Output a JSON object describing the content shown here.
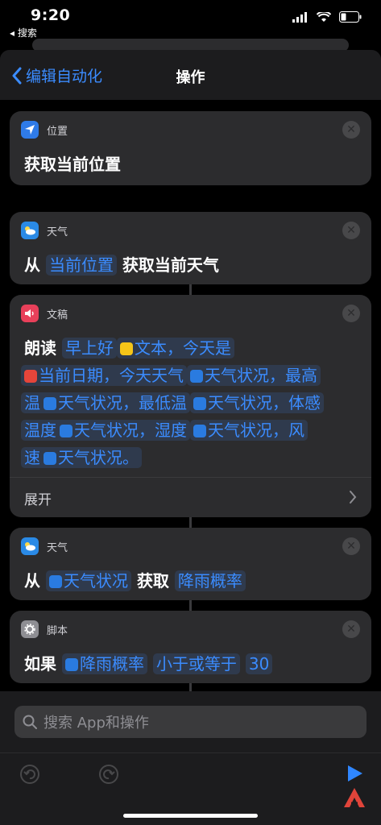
{
  "status": {
    "time": "9:20",
    "back_app": "◂ 搜索"
  },
  "nav": {
    "back_label": "编辑自动化",
    "title": "操作"
  },
  "cards": [
    {
      "app": "位置",
      "line": "获取当前位置"
    },
    {
      "app": "天气",
      "parts": [
        "从",
        "当前位置",
        "获取当前天气"
      ]
    },
    {
      "app": "文稿",
      "lines": [
        [
          "朗读",
          "早上好",
          "文本",
          "，今天是"
        ],
        [
          "当前日期",
          "，今天天气",
          "天气状况",
          "，最高"
        ],
        [
          "温",
          "天气状况",
          "，最低温",
          "天气状况",
          "，体感"
        ],
        [
          "温度",
          "天气状况",
          "，湿度",
          "天气状况",
          "，风"
        ],
        [
          "速",
          "天气状况",
          "。"
        ]
      ],
      "expand": "展开"
    },
    {
      "app": "天气",
      "parts": [
        "从",
        "天气状况",
        "获取",
        "降雨概率"
      ]
    },
    {
      "app": "脚本",
      "parts": [
        "如果",
        "降雨概率",
        "小于或等于",
        "30"
      ]
    }
  ],
  "search": {
    "placeholder": "搜索 App和操作"
  },
  "colors": {
    "accent": "#3b8cff",
    "card": "#2c2c2e",
    "background": "#000000"
  }
}
